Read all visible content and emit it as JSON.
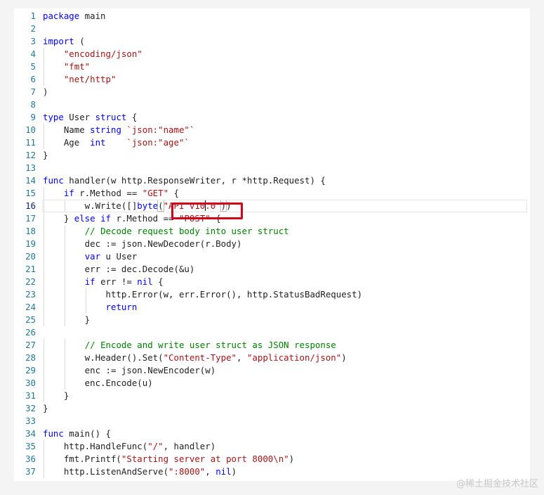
{
  "editor": {
    "lines": [
      {
        "n": "1",
        "t": [
          [
            "kw",
            "package"
          ],
          [
            "",
            " main"
          ]
        ]
      },
      {
        "n": "2",
        "t": []
      },
      {
        "n": "3",
        "t": [
          [
            "kw",
            "import"
          ],
          [
            "",
            " ("
          ]
        ]
      },
      {
        "n": "4",
        "t": [
          [
            "",
            "    "
          ],
          [
            "str",
            "\"encoding/json\""
          ]
        ]
      },
      {
        "n": "5",
        "t": [
          [
            "",
            "    "
          ],
          [
            "str",
            "\"fmt\""
          ]
        ]
      },
      {
        "n": "6",
        "t": [
          [
            "",
            "    "
          ],
          [
            "str",
            "\"net/http\""
          ]
        ]
      },
      {
        "n": "7",
        "t": [
          [
            "",
            ")"
          ]
        ]
      },
      {
        "n": "8",
        "t": []
      },
      {
        "n": "9",
        "t": [
          [
            "kw",
            "type"
          ],
          [
            "",
            " User "
          ],
          [
            "kw",
            "struct"
          ],
          [
            "",
            " {"
          ]
        ]
      },
      {
        "n": "10",
        "t": [
          [
            "",
            "    Name "
          ],
          [
            "kw",
            "string"
          ],
          [
            "",
            " "
          ],
          [
            "str",
            "`json:\"name\"`"
          ]
        ]
      },
      {
        "n": "11",
        "t": [
          [
            "",
            "    Age  "
          ],
          [
            "kw",
            "int"
          ],
          [
            "",
            "    "
          ],
          [
            "str",
            "`json:\"age\"`"
          ]
        ]
      },
      {
        "n": "12",
        "t": [
          [
            "",
            "}"
          ]
        ]
      },
      {
        "n": "13",
        "t": []
      },
      {
        "n": "14",
        "t": [
          [
            "kw",
            "func"
          ],
          [
            "",
            " handler(w http.ResponseWriter, r *http.Request) {"
          ]
        ]
      },
      {
        "n": "15",
        "t": [
          [
            "",
            "    "
          ],
          [
            "kw",
            "if"
          ],
          [
            "",
            " r.Method == "
          ],
          [
            "str",
            "\"GET\""
          ],
          [
            "",
            " {"
          ]
        ]
      },
      {
        "n": "16",
        "t": [
          [
            "",
            "        w.Write([]"
          ],
          [
            "kw",
            "byte"
          ],
          [
            "bm",
            "("
          ],
          [
            "str",
            "\"API v10"
          ],
          [
            "caret",
            ""
          ],
          [
            "str",
            ".0\""
          ],
          [
            "bm",
            ")"
          ],
          [
            "",
            ")"
          ]
        ]
      },
      {
        "n": "17",
        "t": [
          [
            "",
            "    } "
          ],
          [
            "kw",
            "else"
          ],
          [
            "",
            " "
          ],
          [
            "kw",
            "if"
          ],
          [
            "",
            " r.Method == "
          ],
          [
            "str",
            "\"POST\""
          ],
          [
            "",
            " {"
          ]
        ]
      },
      {
        "n": "18",
        "t": [
          [
            "",
            "        "
          ],
          [
            "cm",
            "// Decode request body into user struct"
          ]
        ]
      },
      {
        "n": "19",
        "t": [
          [
            "",
            "        dec := json.NewDecoder(r.Body)"
          ]
        ]
      },
      {
        "n": "20",
        "t": [
          [
            "",
            "        "
          ],
          [
            "kw",
            "var"
          ],
          [
            "",
            " u User"
          ]
        ]
      },
      {
        "n": "21",
        "t": [
          [
            "",
            "        err := dec.Decode(&u)"
          ]
        ]
      },
      {
        "n": "22",
        "t": [
          [
            "",
            "        "
          ],
          [
            "kw",
            "if"
          ],
          [
            "",
            " err != "
          ],
          [
            "kw",
            "nil"
          ],
          [
            "",
            " {"
          ]
        ]
      },
      {
        "n": "23",
        "t": [
          [
            "",
            "            http.Error(w, err.Error(), http.StatusBadRequest)"
          ]
        ]
      },
      {
        "n": "24",
        "t": [
          [
            "",
            "            "
          ],
          [
            "kw",
            "return"
          ]
        ]
      },
      {
        "n": "25",
        "t": [
          [
            "",
            "        }"
          ]
        ]
      },
      {
        "n": "26",
        "t": []
      },
      {
        "n": "27",
        "t": [
          [
            "",
            "        "
          ],
          [
            "cm",
            "// Encode and write user struct as JSON response"
          ]
        ]
      },
      {
        "n": "28",
        "t": [
          [
            "",
            "        w.Header().Set("
          ],
          [
            "str",
            "\"Content-Type\""
          ],
          [
            "",
            ", "
          ],
          [
            "str",
            "\"application/json\""
          ],
          [
            "",
            ")"
          ]
        ]
      },
      {
        "n": "29",
        "t": [
          [
            "",
            "        enc := json.NewEncoder(w)"
          ]
        ]
      },
      {
        "n": "30",
        "t": [
          [
            "",
            "        enc.Encode(u)"
          ]
        ]
      },
      {
        "n": "31",
        "t": [
          [
            "",
            "    }"
          ]
        ]
      },
      {
        "n": "32",
        "t": [
          [
            "",
            "}"
          ]
        ]
      },
      {
        "n": "33",
        "t": []
      },
      {
        "n": "34",
        "t": [
          [
            "kw",
            "func"
          ],
          [
            "",
            " main() {"
          ]
        ]
      },
      {
        "n": "35",
        "t": [
          [
            "",
            "    http.HandleFunc("
          ],
          [
            "str",
            "\"/\""
          ],
          [
            "",
            ", handler)"
          ]
        ]
      },
      {
        "n": "36",
        "t": [
          [
            "",
            "    fmt.Printf("
          ],
          [
            "str",
            "\"Starting server at port 8000\\n\""
          ],
          [
            "",
            ")"
          ]
        ]
      },
      {
        "n": "37",
        "t": [
          [
            "",
            "    http.ListenAndServe("
          ],
          [
            "str",
            "\":8000\""
          ],
          [
            "",
            ", "
          ],
          [
            "kw",
            "nil"
          ],
          [
            "",
            ")"
          ]
        ]
      }
    ],
    "current_line": "16"
  },
  "colors": {
    "keyword": "#0000ff",
    "string": "#a31515",
    "comment": "#008000",
    "line_number": "#237893",
    "highlight_box": "#d0021b"
  },
  "watermark": "@稀土掘金技术社区"
}
